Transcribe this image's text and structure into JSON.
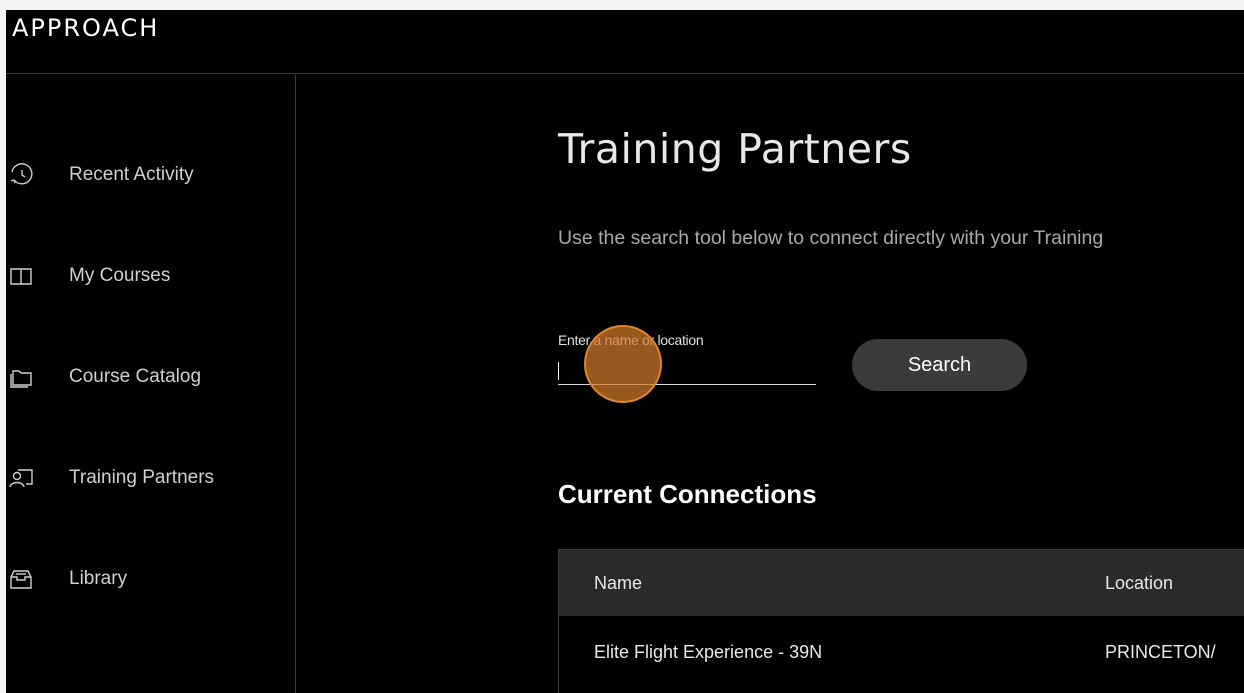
{
  "app": {
    "logo_text": "APPROACH"
  },
  "sidebar": {
    "items": [
      {
        "label": "Recent Activity",
        "icon": "history-icon"
      },
      {
        "label": "My Courses",
        "icon": "book-icon"
      },
      {
        "label": "Course Catalog",
        "icon": "folder-icon"
      },
      {
        "label": "Training Partners",
        "icon": "partner-icon"
      },
      {
        "label": "Library",
        "icon": "archive-icon"
      }
    ]
  },
  "main": {
    "title": "Training Partners",
    "description": "Use the search tool below to connect directly with your Training",
    "search": {
      "label": "Enter a name or location",
      "value": "",
      "button_label": "Search"
    },
    "connections": {
      "title": "Current Connections",
      "columns": [
        "Name",
        "Location"
      ],
      "rows": [
        {
          "name": "Elite Flight Experience - 39N",
          "location": "PRINCETON/"
        }
      ]
    }
  },
  "colors": {
    "background": "#000000",
    "button": "#3b3b3b",
    "table_header": "#2a2a2a",
    "click_marker": "#d47a28"
  }
}
